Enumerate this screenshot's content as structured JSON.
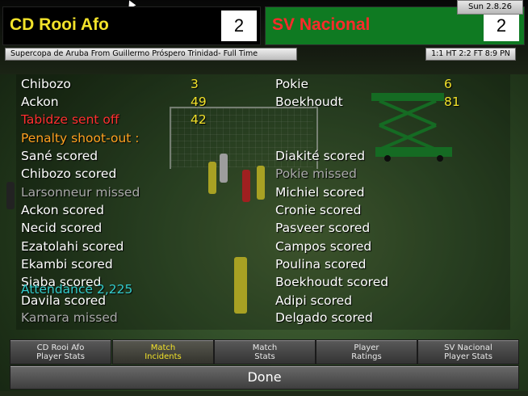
{
  "header": {
    "home_team": "CD Rooi Afo",
    "home_score": "2",
    "away_team": "SV Nacional",
    "away_score": "2",
    "date": "Sun 2.8.26",
    "competition": "Supercopa de Aruba From Guillermo Próspero Trinidad- Full Time",
    "score_summary": "1:1 HT 2:2 FT 8:9 PN",
    "colors": {
      "home_name": "#f2e22a",
      "away_name": "#ff2a2a",
      "away_bg": "#0f7a22",
      "minute": "#f2e22a"
    }
  },
  "incidents": {
    "home_goals": [
      {
        "player": "Chibozo",
        "minute": "3"
      },
      {
        "player": "Ackon",
        "minute": "49"
      }
    ],
    "red_card": {
      "text": "Tabidze sent off",
      "minute": "42"
    },
    "away_goals": [
      {
        "player": "Pokie",
        "minute": "6"
      },
      {
        "player": "Boekhoudt",
        "minute": "81"
      }
    ],
    "shootout_title": "Penalty shoot-out :",
    "home_penalties": [
      {
        "text": "Sané scored",
        "missed": false
      },
      {
        "text": "Chibozo scored",
        "missed": false
      },
      {
        "text": "Larsonneur missed",
        "missed": true
      },
      {
        "text": "Ackon scored",
        "missed": false
      },
      {
        "text": "Necid scored",
        "missed": false
      },
      {
        "text": "Ezatolahi scored",
        "missed": false
      },
      {
        "text": "Ekambi scored",
        "missed": false
      },
      {
        "text": "Siaba scored",
        "missed": false
      },
      {
        "text": "Davila scored",
        "missed": false
      },
      {
        "text": "Kamara missed",
        "missed": true
      }
    ],
    "away_penalties": [
      {
        "text": "Diakité scored",
        "missed": false
      },
      {
        "text": "Pokie missed",
        "missed": true
      },
      {
        "text": "Michiel scored",
        "missed": false
      },
      {
        "text": "Cronie scored",
        "missed": false
      },
      {
        "text": "Pasveer scored",
        "missed": false
      },
      {
        "text": "Campos scored",
        "missed": false
      },
      {
        "text": "Poulina scored",
        "missed": false
      },
      {
        "text": "Boekhoudt scored",
        "missed": false
      },
      {
        "text": "Adipi scored",
        "missed": false
      },
      {
        "text": "Delgado scored",
        "missed": false
      }
    ],
    "attendance": "Attendance 2,225"
  },
  "tabs": [
    {
      "line1": "CD Rooi Afo",
      "line2": "Player Stats",
      "active": false
    },
    {
      "line1": "Match",
      "line2": "Incidents",
      "active": true
    },
    {
      "line1": "Match",
      "line2": "Stats",
      "active": false
    },
    {
      "line1": "Player",
      "line2": "Ratings",
      "active": false
    },
    {
      "line1": "SV Nacional",
      "line2": "Player Stats",
      "active": false
    }
  ],
  "done_label": "Done"
}
